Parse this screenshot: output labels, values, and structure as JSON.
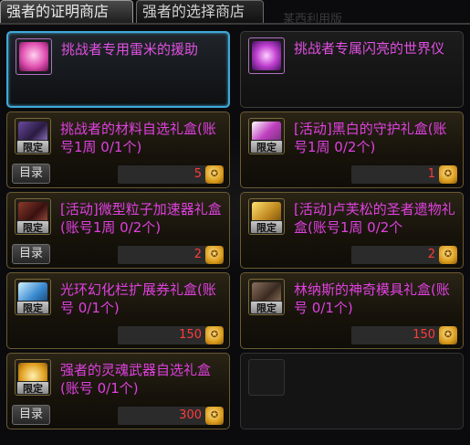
{
  "tabs": [
    {
      "label": "强者的证明商店"
    },
    {
      "label": "强者的选择商店"
    }
  ],
  "top_deco_text": "某西利用版",
  "catalog_label": "目录",
  "badge_label": "限定",
  "items": [
    {
      "name": "挑战者专用雷米的援助",
      "selected": true
    },
    {
      "name": "挑战者专属闪亮的世界仪"
    },
    {
      "name": "挑战者的材料自选礼盒(账号1周 0/1个)",
      "price": "5",
      "badge": true
    },
    {
      "name": "[活动]黑白的守护礼盒(账号1周 0/2个)",
      "price": "1",
      "badge": true
    },
    {
      "name": "[活动]微型粒子加速器礼盒(账号1周 0/2个)",
      "price": "2",
      "badge": true
    },
    {
      "name": "[活动]卢芙松的圣者遗物礼盒(账号1周 0/2个",
      "price": "2",
      "badge": true
    },
    {
      "name": "光环幻化栏扩展券礼盒(账号 0/1个)",
      "price": "150",
      "badge": true
    },
    {
      "name": "林纳斯的神奇模具礼盒(账号 0/1个)",
      "price": "150",
      "badge": true
    },
    {
      "name": "强者的灵魂武器自选礼盒(账号 0/1个)",
      "price": "300",
      "badge": true
    },
    {
      "name": ""
    }
  ],
  "currency_icon": "coin-icon"
}
